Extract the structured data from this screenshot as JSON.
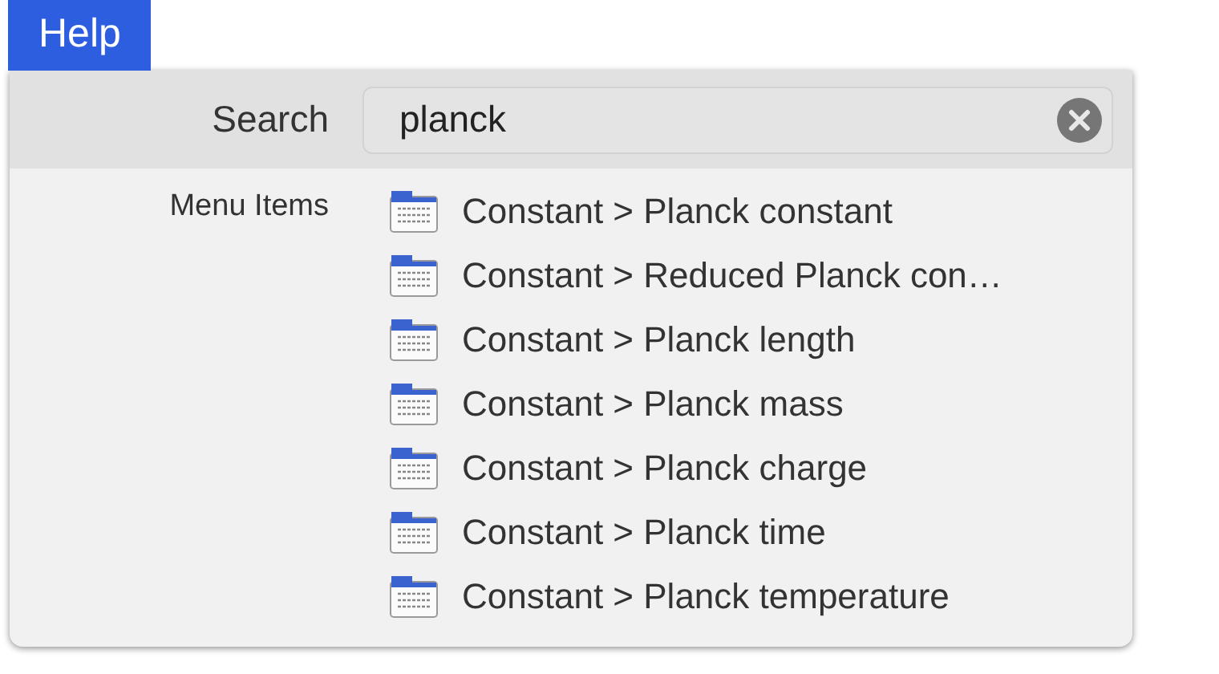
{
  "menu_bar": [
    {
      "label": "Help",
      "selected": true
    }
  ],
  "search": {
    "label": "Search",
    "value": "planck"
  },
  "results": {
    "section": "Menu Items",
    "items": [
      {
        "label": "Constant > Planck constant"
      },
      {
        "label": "Constant > Reduced Planck con…"
      },
      {
        "label": "Constant > Planck length"
      },
      {
        "label": "Constant > Planck mass"
      },
      {
        "label": "Constant > Planck charge"
      },
      {
        "label": "Constant > Planck time"
      },
      {
        "label": "Constant > Planck temperature"
      }
    ]
  }
}
